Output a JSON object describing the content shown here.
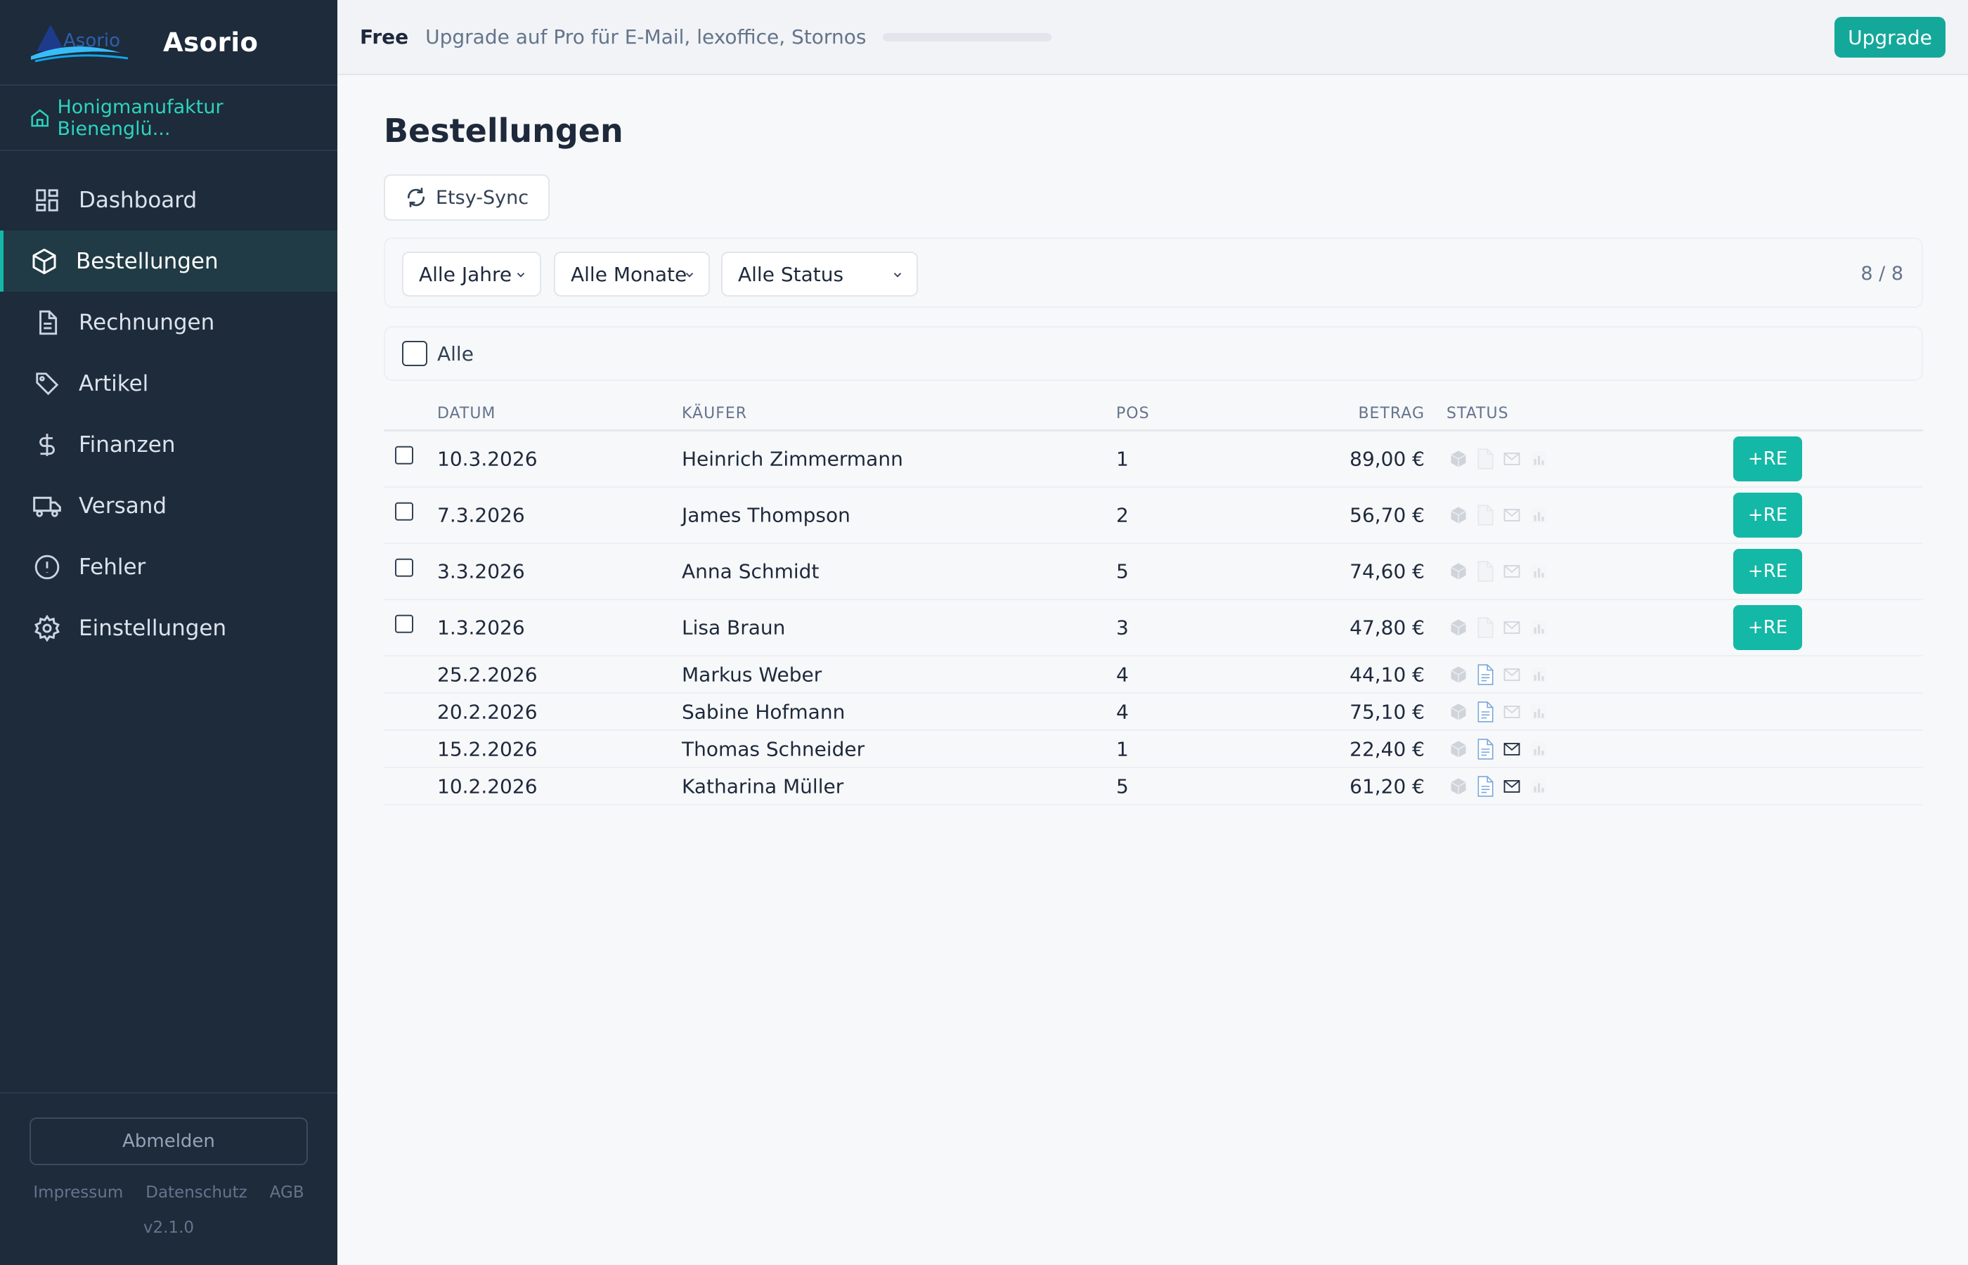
{
  "app": {
    "name": "Asorio",
    "logo_text": "Asorio",
    "organization": "Honigmanufaktur Bienenglü..."
  },
  "sidebar": {
    "items": [
      {
        "label": "Dashboard",
        "icon": "dashboard-icon",
        "active": false
      },
      {
        "label": "Bestellungen",
        "icon": "box-icon",
        "active": true
      },
      {
        "label": "Rechnungen",
        "icon": "document-icon",
        "active": false
      },
      {
        "label": "Artikel",
        "icon": "tag-icon",
        "active": false
      },
      {
        "label": "Finanzen",
        "icon": "dollar-icon",
        "active": false
      },
      {
        "label": "Versand",
        "icon": "truck-icon",
        "active": false
      },
      {
        "label": "Fehler",
        "icon": "alert-icon",
        "active": false
      },
      {
        "label": "Einstellungen",
        "icon": "gear-icon",
        "active": false
      }
    ],
    "logout_label": "Abmelden",
    "footer_links": [
      "Impressum",
      "Datenschutz",
      "AGB"
    ],
    "version": "v2.1.0"
  },
  "topbar": {
    "plan": "Free",
    "upgrade_text": "Upgrade auf Pro für E-Mail, lexoffice, Stornos",
    "usage_fraction": 0,
    "upgrade_label": "Upgrade"
  },
  "page": {
    "title": "Bestellungen",
    "sync_label": "Etsy-Sync",
    "filters": {
      "year": "Alle Jahre",
      "month": "Alle Monate",
      "status": "Alle Status"
    },
    "count": "8 / 8",
    "select_all_label": "Alle"
  },
  "table": {
    "headers": {
      "date": "DATUM",
      "buyer": "KÄUFER",
      "pos": "POS",
      "amount": "BETRAG",
      "status": "STATUS"
    },
    "action_label": "+RE",
    "rows": [
      {
        "date": "10.3.2026",
        "buyer": "Heinrich Zimmermann",
        "pos": "1",
        "amount": "89,00 €",
        "selectable": true,
        "invoice": false,
        "mail": false
      },
      {
        "date": "7.3.2026",
        "buyer": "James Thompson",
        "pos": "2",
        "amount": "56,70 €",
        "selectable": true,
        "invoice": false,
        "mail": false
      },
      {
        "date": "3.3.2026",
        "buyer": "Anna Schmidt",
        "pos": "5",
        "amount": "74,60 €",
        "selectable": true,
        "invoice": false,
        "mail": false
      },
      {
        "date": "1.3.2026",
        "buyer": "Lisa Braun",
        "pos": "3",
        "amount": "47,80 €",
        "selectable": true,
        "invoice": false,
        "mail": false
      },
      {
        "date": "25.2.2026",
        "buyer": "Markus Weber",
        "pos": "4",
        "amount": "44,10 €",
        "selectable": false,
        "invoice": true,
        "mail": false
      },
      {
        "date": "20.2.2026",
        "buyer": "Sabine Hofmann",
        "pos": "4",
        "amount": "75,10 €",
        "selectable": false,
        "invoice": true,
        "mail": false
      },
      {
        "date": "15.2.2026",
        "buyer": "Thomas Schneider",
        "pos": "1",
        "amount": "22,40 €",
        "selectable": false,
        "invoice": true,
        "mail": true
      },
      {
        "date": "10.2.2026",
        "buyer": "Katharina Müller",
        "pos": "5",
        "amount": "61,20 €",
        "selectable": false,
        "invoice": true,
        "mail": true
      }
    ]
  },
  "colors": {
    "accent": "#14b8a6",
    "sidebar_bg": "#1d2b3b",
    "org_text": "#2dd4bf"
  }
}
